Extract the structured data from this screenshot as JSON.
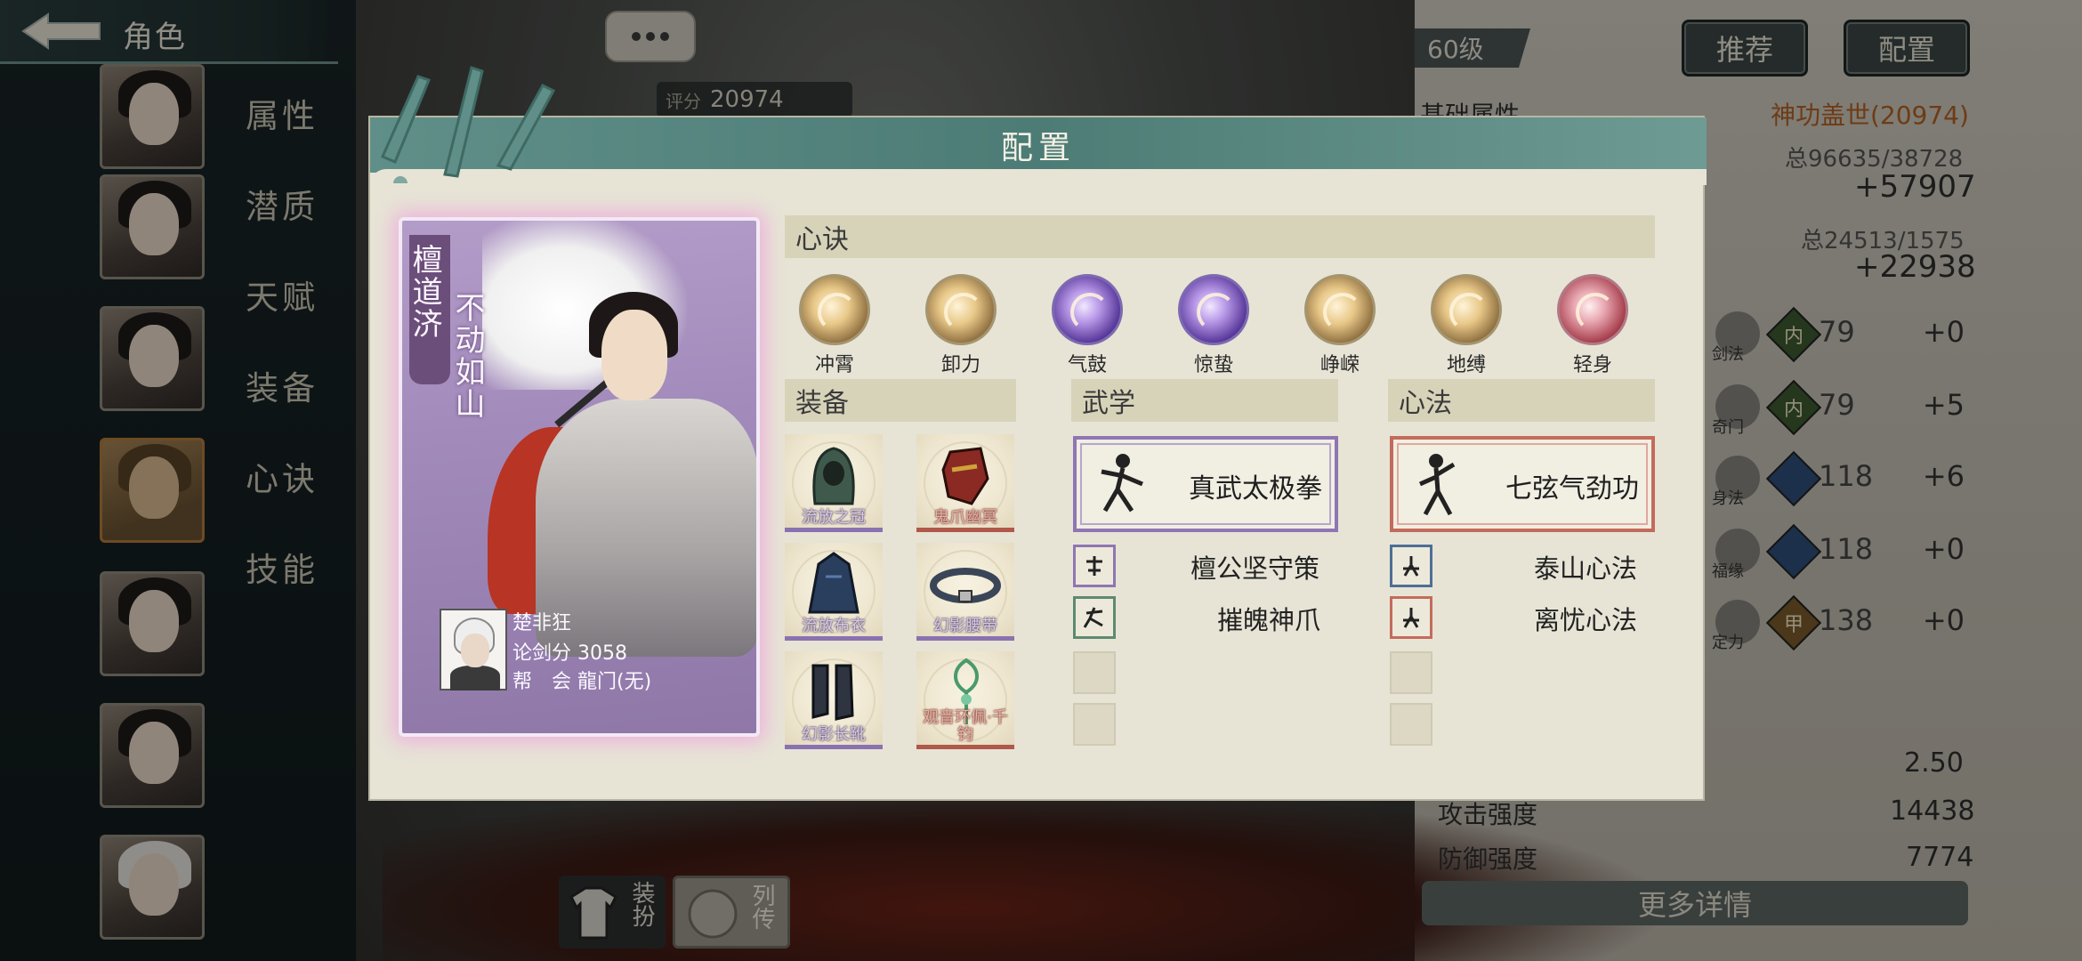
{
  "topbar": {
    "title": "角色"
  },
  "background": {
    "score_label": "评分",
    "score_value": "20974",
    "level": "60级",
    "buttons": {
      "recommend": "推荐",
      "config": "配置"
    },
    "base_attr_label": "基础属性",
    "power_text": "神功盖世(20974)",
    "total1": "总96635/38728",
    "delta1": "+57907",
    "total2": "总24513/1575",
    "delta2": "+22938",
    "stats": [
      {
        "label": "剑法",
        "badge": "内",
        "value": "79",
        "plus": "+0",
        "color": "green"
      },
      {
        "label": "奇门",
        "badge": "内",
        "value": "79",
        "plus": "+5",
        "color": "green"
      },
      {
        "label": "身法",
        "badge": "",
        "value": "118",
        "plus": "+6",
        "color": "blue"
      },
      {
        "label": "福缘",
        "badge": "",
        "value": "118",
        "plus": "+0",
        "color": "blue"
      },
      {
        "label": "定力",
        "badge": "甲",
        "value": "138",
        "plus": "+0",
        "color": "brown"
      }
    ],
    "val_a": "2.50",
    "attack_label": "攻击强度",
    "attack_value": "14438",
    "defense_label": "防御强度",
    "defense_value": "7774",
    "more_details": "更多详情",
    "side_menu": [
      "属性",
      "潜质",
      "天赋",
      "装备",
      "心诀",
      "技能"
    ],
    "bottom_buttons": {
      "dress": "装扮",
      "bio": "列传"
    }
  },
  "modal": {
    "title": "配置",
    "hero": {
      "name": "檀道济",
      "title": "不动如山",
      "player_name": "楚非狂",
      "score_label": "论剑分",
      "score_value": "3058",
      "guild_label": "帮　会",
      "guild_value": "龍门(无)"
    },
    "sections": {
      "xinjue": "心诀",
      "equipment": "装备",
      "martial": "武学",
      "heart": "心法"
    },
    "xinjue_items": [
      {
        "label": "冲霄",
        "style": "gold"
      },
      {
        "label": "卸力",
        "style": "gold"
      },
      {
        "label": "气鼓",
        "style": "purple"
      },
      {
        "label": "惊蛰",
        "style": "purple"
      },
      {
        "label": "峥嵘",
        "style": "gold"
      },
      {
        "label": "地缚",
        "style": "gold"
      },
      {
        "label": "轻身",
        "style": "red"
      }
    ],
    "equipment_items": [
      {
        "name": "流放之冠",
        "color": "purple"
      },
      {
        "name": "鬼爪幽冥",
        "color": "red"
      },
      {
        "name": "流放布衣",
        "color": "purple"
      },
      {
        "name": "幻影腰带",
        "color": "purple"
      },
      {
        "name": "幻影长靴",
        "color": "purple"
      },
      {
        "name": "观音环佩·千钧",
        "color": "red"
      }
    ],
    "martial": {
      "main": "真武太极拳",
      "subs": [
        "檀公坚守策",
        "摧魄神爪"
      ]
    },
    "heart": {
      "main": "七弦气劲功",
      "subs": [
        "泰山心法",
        "离忧心法"
      ]
    }
  }
}
